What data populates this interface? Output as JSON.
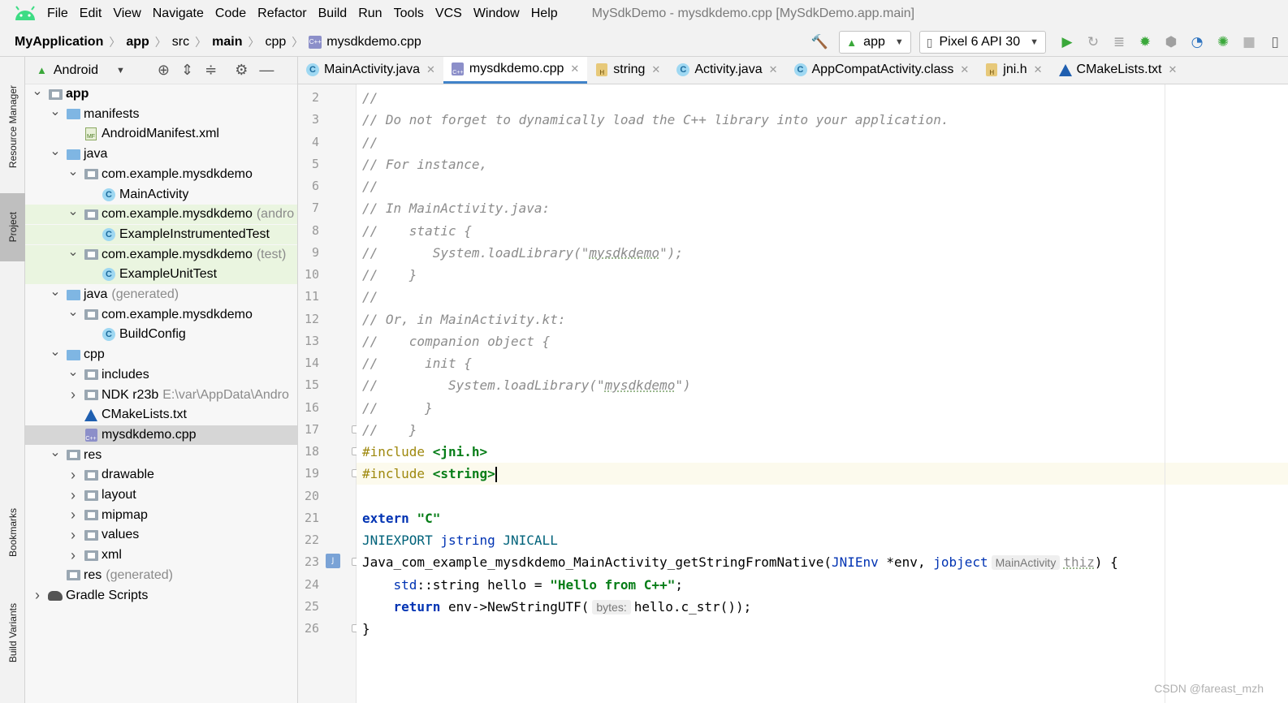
{
  "window": {
    "title": "MySdkDemo - mysdkdemo.cpp [MySdkDemo.app.main]",
    "menu": [
      "File",
      "Edit",
      "View",
      "Navigate",
      "Code",
      "Refactor",
      "Build",
      "Run",
      "Tools",
      "VCS",
      "Window",
      "Help"
    ]
  },
  "breadcrumb": [
    "MyApplication",
    "app",
    "src",
    "main",
    "cpp",
    "mysdkdemo.cpp"
  ],
  "toolbar": {
    "run_config": "app",
    "device": "Pixel 6 API 30"
  },
  "side_tabs": {
    "resource_manager": "Resource Manager",
    "project": "Project",
    "bookmarks": "Bookmarks",
    "build_variants": "Build Variants"
  },
  "project": {
    "view_mode": "Android",
    "tree": [
      {
        "label": "app",
        "hint": "",
        "depth": 0,
        "expanded": true,
        "icon": "module-folder",
        "bold": true
      },
      {
        "label": "manifests",
        "hint": "",
        "depth": 1,
        "expanded": true,
        "icon": "folder"
      },
      {
        "label": "AndroidManifest.xml",
        "hint": "",
        "depth": 2,
        "expanded": null,
        "icon": "manifest-file"
      },
      {
        "label": "java",
        "hint": "",
        "depth": 1,
        "expanded": true,
        "icon": "folder"
      },
      {
        "label": "com.example.mysdkdemo",
        "hint": "",
        "depth": 2,
        "expanded": true,
        "icon": "package"
      },
      {
        "label": "MainActivity",
        "hint": "",
        "depth": 3,
        "expanded": null,
        "icon": "class"
      },
      {
        "label": "com.example.mysdkdemo",
        "hint": "(andro",
        "depth": 2,
        "expanded": true,
        "icon": "package",
        "test": true
      },
      {
        "label": "ExampleInstrumentedTest",
        "hint": "",
        "depth": 3,
        "expanded": null,
        "icon": "test-class",
        "test": true
      },
      {
        "label": "com.example.mysdkdemo",
        "hint": "(test)",
        "depth": 2,
        "expanded": true,
        "icon": "package",
        "test": true
      },
      {
        "label": "ExampleUnitTest",
        "hint": "",
        "depth": 3,
        "expanded": null,
        "icon": "test-class",
        "test": true
      },
      {
        "label": "java",
        "hint": "(generated)",
        "depth": 1,
        "expanded": true,
        "icon": "generated-folder"
      },
      {
        "label": "com.example.mysdkdemo",
        "hint": "",
        "depth": 2,
        "expanded": true,
        "icon": "package"
      },
      {
        "label": "BuildConfig",
        "hint": "",
        "depth": 3,
        "expanded": null,
        "icon": "class"
      },
      {
        "label": "cpp",
        "hint": "",
        "depth": 1,
        "expanded": true,
        "icon": "folder"
      },
      {
        "label": "includes",
        "hint": "",
        "depth": 2,
        "expanded": true,
        "icon": "package"
      },
      {
        "label": "NDK r23b",
        "hint": "E:\\var\\AppData\\Andro",
        "depth": 2,
        "expanded": false,
        "icon": "package"
      },
      {
        "label": "CMakeLists.txt",
        "hint": "",
        "depth": 2,
        "expanded": null,
        "icon": "cmake-file"
      },
      {
        "label": "mysdkdemo.cpp",
        "hint": "",
        "depth": 2,
        "expanded": null,
        "icon": "cpp-file",
        "selected": true
      },
      {
        "label": "res",
        "hint": "",
        "depth": 1,
        "expanded": true,
        "icon": "res-folder"
      },
      {
        "label": "drawable",
        "hint": "",
        "depth": 2,
        "expanded": false,
        "icon": "package"
      },
      {
        "label": "layout",
        "hint": "",
        "depth": 2,
        "expanded": false,
        "icon": "package"
      },
      {
        "label": "mipmap",
        "hint": "",
        "depth": 2,
        "expanded": false,
        "icon": "package"
      },
      {
        "label": "values",
        "hint": "",
        "depth": 2,
        "expanded": false,
        "icon": "package"
      },
      {
        "label": "xml",
        "hint": "",
        "depth": 2,
        "expanded": false,
        "icon": "package"
      },
      {
        "label": "res",
        "hint": "(generated)",
        "depth": 1,
        "expanded": null,
        "icon": "res-folder"
      },
      {
        "label": "Gradle Scripts",
        "hint": "",
        "depth": 0,
        "expanded": false,
        "icon": "gradle"
      }
    ]
  },
  "tabs": [
    {
      "label": "MainActivity.java",
      "icon": "class",
      "active": false
    },
    {
      "label": "mysdkdemo.cpp",
      "icon": "cpp-file",
      "active": true
    },
    {
      "label": "string",
      "icon": "header-file",
      "active": false
    },
    {
      "label": "Activity.java",
      "icon": "class",
      "active": false
    },
    {
      "label": "AppCompatActivity.class",
      "icon": "class",
      "active": false
    },
    {
      "label": "jni.h",
      "icon": "header-file",
      "active": false
    },
    {
      "label": "CMakeLists.txt",
      "icon": "cmake-file",
      "active": false
    }
  ],
  "editor": {
    "current_line": 19,
    "lines": [
      {
        "n": "2",
        "parts": [
          [
            "cmt",
            "//"
          ]
        ]
      },
      {
        "n": "3",
        "parts": [
          [
            "cmt",
            "// Do not forget to dynamically load the C++ library into your application."
          ]
        ]
      },
      {
        "n": "4",
        "parts": [
          [
            "cmt",
            "//"
          ]
        ]
      },
      {
        "n": "5",
        "parts": [
          [
            "cmt",
            "// For instance,"
          ]
        ]
      },
      {
        "n": "6",
        "parts": [
          [
            "cmt",
            "//"
          ]
        ]
      },
      {
        "n": "7",
        "parts": [
          [
            "cmt",
            "// In MainActivity.java:"
          ]
        ]
      },
      {
        "n": "8",
        "parts": [
          [
            "cmt",
            "//    static {"
          ]
        ]
      },
      {
        "n": "9",
        "parts": [
          [
            "cmt",
            "//       System.loadLibrary(\""
          ],
          [
            "cmt ul",
            "mysdkdemo"
          ],
          [
            "cmt",
            "\");"
          ]
        ]
      },
      {
        "n": "10",
        "parts": [
          [
            "cmt",
            "//    }"
          ]
        ]
      },
      {
        "n": "11",
        "parts": [
          [
            "cmt",
            "//"
          ]
        ]
      },
      {
        "n": "12",
        "parts": [
          [
            "cmt",
            "// Or, in MainActivity.kt:"
          ]
        ]
      },
      {
        "n": "13",
        "parts": [
          [
            "cmt",
            "//    companion object {"
          ]
        ]
      },
      {
        "n": "14",
        "parts": [
          [
            "cmt",
            "//      init {"
          ]
        ]
      },
      {
        "n": "15",
        "parts": [
          [
            "cmt",
            "//         System.loadLibrary(\""
          ],
          [
            "cmt ul",
            "mysdkdemo"
          ],
          [
            "cmt",
            "\")"
          ]
        ]
      },
      {
        "n": "16",
        "parts": [
          [
            "cmt",
            "//      }"
          ]
        ]
      },
      {
        "n": "17",
        "parts": [
          [
            "cmt",
            "//    }"
          ]
        ]
      },
      {
        "n": "18",
        "parts": [
          [
            "inc",
            "#include "
          ],
          [
            "hdr",
            "<jni.h>"
          ]
        ]
      },
      {
        "n": "19",
        "parts": [
          [
            "inc",
            "#include "
          ],
          [
            "hdr",
            "<string>"
          ],
          [
            "caret",
            ""
          ]
        ]
      },
      {
        "n": "20",
        "parts": []
      },
      {
        "n": "21",
        "parts": [
          [
            "kw",
            "extern "
          ],
          [
            "str",
            "\"C\""
          ]
        ]
      },
      {
        "n": "22",
        "parts": [
          [
            "grn",
            "JNIEXPORT "
          ],
          [
            "typ",
            "jstring "
          ],
          [
            "grn",
            "JNICALL"
          ]
        ]
      },
      {
        "n": "23",
        "parts": [
          [
            "",
            "Java_com_example_mysdkdemo_MainActivity_getStringFromNative("
          ],
          [
            "typ",
            "JNIEnv "
          ],
          [
            "",
            "*env, "
          ],
          [
            "typ",
            "jobject"
          ],
          [
            "inlay",
            "MainActivity"
          ],
          [
            "ul grey",
            "thiz"
          ],
          [
            "",
            ") {"
          ]
        ]
      },
      {
        "n": "24",
        "parts": [
          [
            "",
            "    "
          ],
          [
            "typ",
            "std"
          ],
          [
            "",
            "::string hello = "
          ],
          [
            "str",
            "\"Hello from C++\""
          ],
          [
            "",
            ";"
          ]
        ]
      },
      {
        "n": "25",
        "parts": [
          [
            "",
            "    "
          ],
          [
            "kw",
            "return "
          ],
          [
            "",
            "env->NewStringUTF("
          ],
          [
            "inlay",
            "bytes:"
          ],
          [
            "",
            "hello.c_str());"
          ]
        ]
      },
      {
        "n": "26",
        "parts": [
          [
            "",
            "}"
          ]
        ]
      }
    ]
  },
  "watermark": "CSDN @fareast_mzh",
  "colors": {
    "menu_bg": "#f2f2f2",
    "test_row_bg": "#eaf5e0",
    "selected_row_bg": "#d6d6d6",
    "current_line_bg": "#fcfaed",
    "keyword": "#0033b3",
    "string": "#067d17",
    "comment": "#8c8c8c",
    "active_tab_underline": "#4083c9",
    "run_green": "#3aa83a"
  }
}
